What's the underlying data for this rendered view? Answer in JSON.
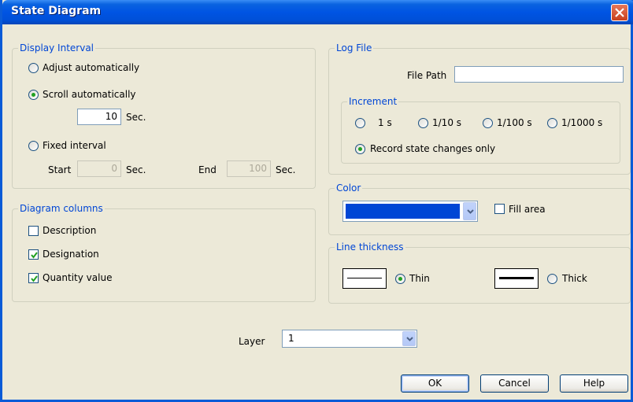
{
  "window": {
    "title": "State Diagram"
  },
  "display_interval": {
    "legend": "Display Interval",
    "adjust_label": "Adjust automatically",
    "scroll_label": "Scroll automatically",
    "scroll_value": "10",
    "scroll_unit": "Sec.",
    "fixed_label": "Fixed interval",
    "start_label": "Start",
    "start_value": "0",
    "start_unit": "Sec.",
    "end_label": "End",
    "end_value": "100",
    "end_unit": "Sec.",
    "selected": "scroll"
  },
  "diagram_columns": {
    "legend": "Diagram columns",
    "items": [
      {
        "label": "Description",
        "checked": false
      },
      {
        "label": "Designation",
        "checked": true
      },
      {
        "label": "Quantity value",
        "checked": true
      }
    ]
  },
  "log_file": {
    "legend": "Log File",
    "file_path_label": "File Path",
    "file_path_value": "",
    "increment": {
      "legend": "Increment",
      "options": [
        "1 s",
        "1/10 s",
        "1/100 s",
        "1/1000 s"
      ],
      "record_label": "Record state changes only",
      "selected": "record"
    }
  },
  "color": {
    "legend": "Color",
    "swatch": "#0046D5",
    "fill_label": "Fill area",
    "fill_checked": false
  },
  "line_thickness": {
    "legend": "Line thickness",
    "thin_label": "Thin",
    "thick_label": "Thick",
    "selected": "thin"
  },
  "layer": {
    "label": "Layer",
    "value": "1"
  },
  "buttons": {
    "ok": "OK",
    "cancel": "Cancel",
    "help": "Help"
  }
}
